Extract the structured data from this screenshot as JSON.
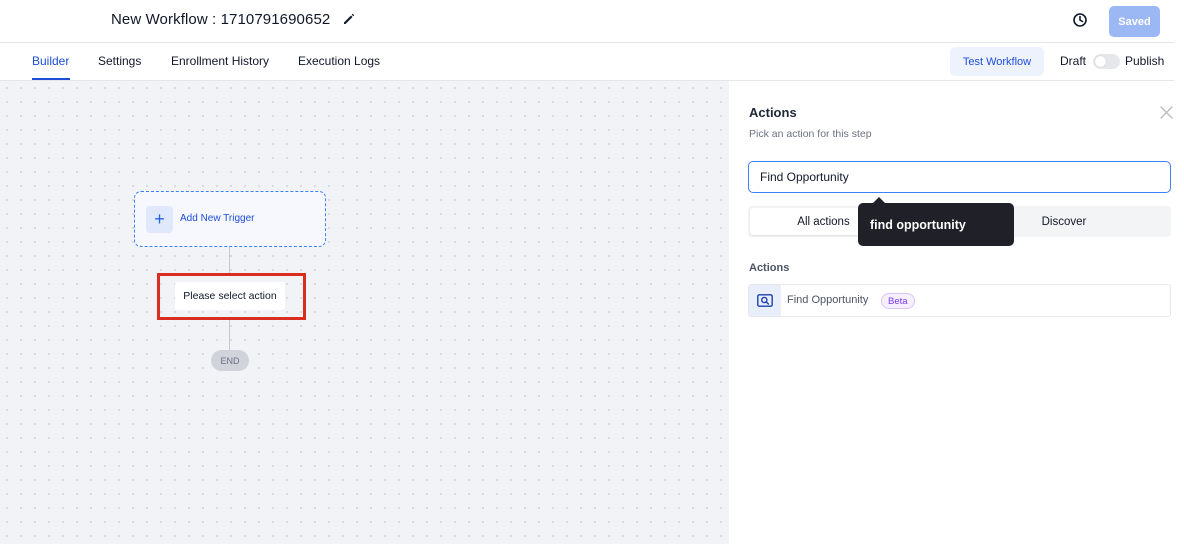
{
  "header": {
    "title": "New Workflow : 1710791690652",
    "saved_label": "Saved"
  },
  "tabs": [
    {
      "label": "Builder",
      "active": true
    },
    {
      "label": "Settings",
      "active": false
    },
    {
      "label": "Enrollment History",
      "active": false
    },
    {
      "label": "Execution Logs",
      "active": false
    }
  ],
  "toolbar": {
    "test_workflow_label": "Test Workflow",
    "draft_label": "Draft",
    "publish_label": "Publish",
    "publish_toggle_on": false
  },
  "canvas": {
    "trigger_label": "Add New Trigger",
    "action_placeholder": "Please select action",
    "end_label": "END"
  },
  "panel": {
    "title": "Actions",
    "subtitle": "Pick an action for this step",
    "search_value": "Find Opportunity",
    "segments": [
      {
        "label": "All actions",
        "active": true
      },
      {
        "label": "Discover",
        "active": false
      }
    ],
    "tooltip": "find opportunity",
    "section_label": "Actions",
    "results": [
      {
        "name": "Find Opportunity",
        "badge": "Beta",
        "icon": "search-record-icon"
      }
    ]
  },
  "colors": {
    "accent": "#1d4ed8",
    "saved_button": "#9bb7f4",
    "highlight": "#d92d20",
    "tooltip_bg": "#1f2028",
    "beta_text": "#7c3aed"
  }
}
